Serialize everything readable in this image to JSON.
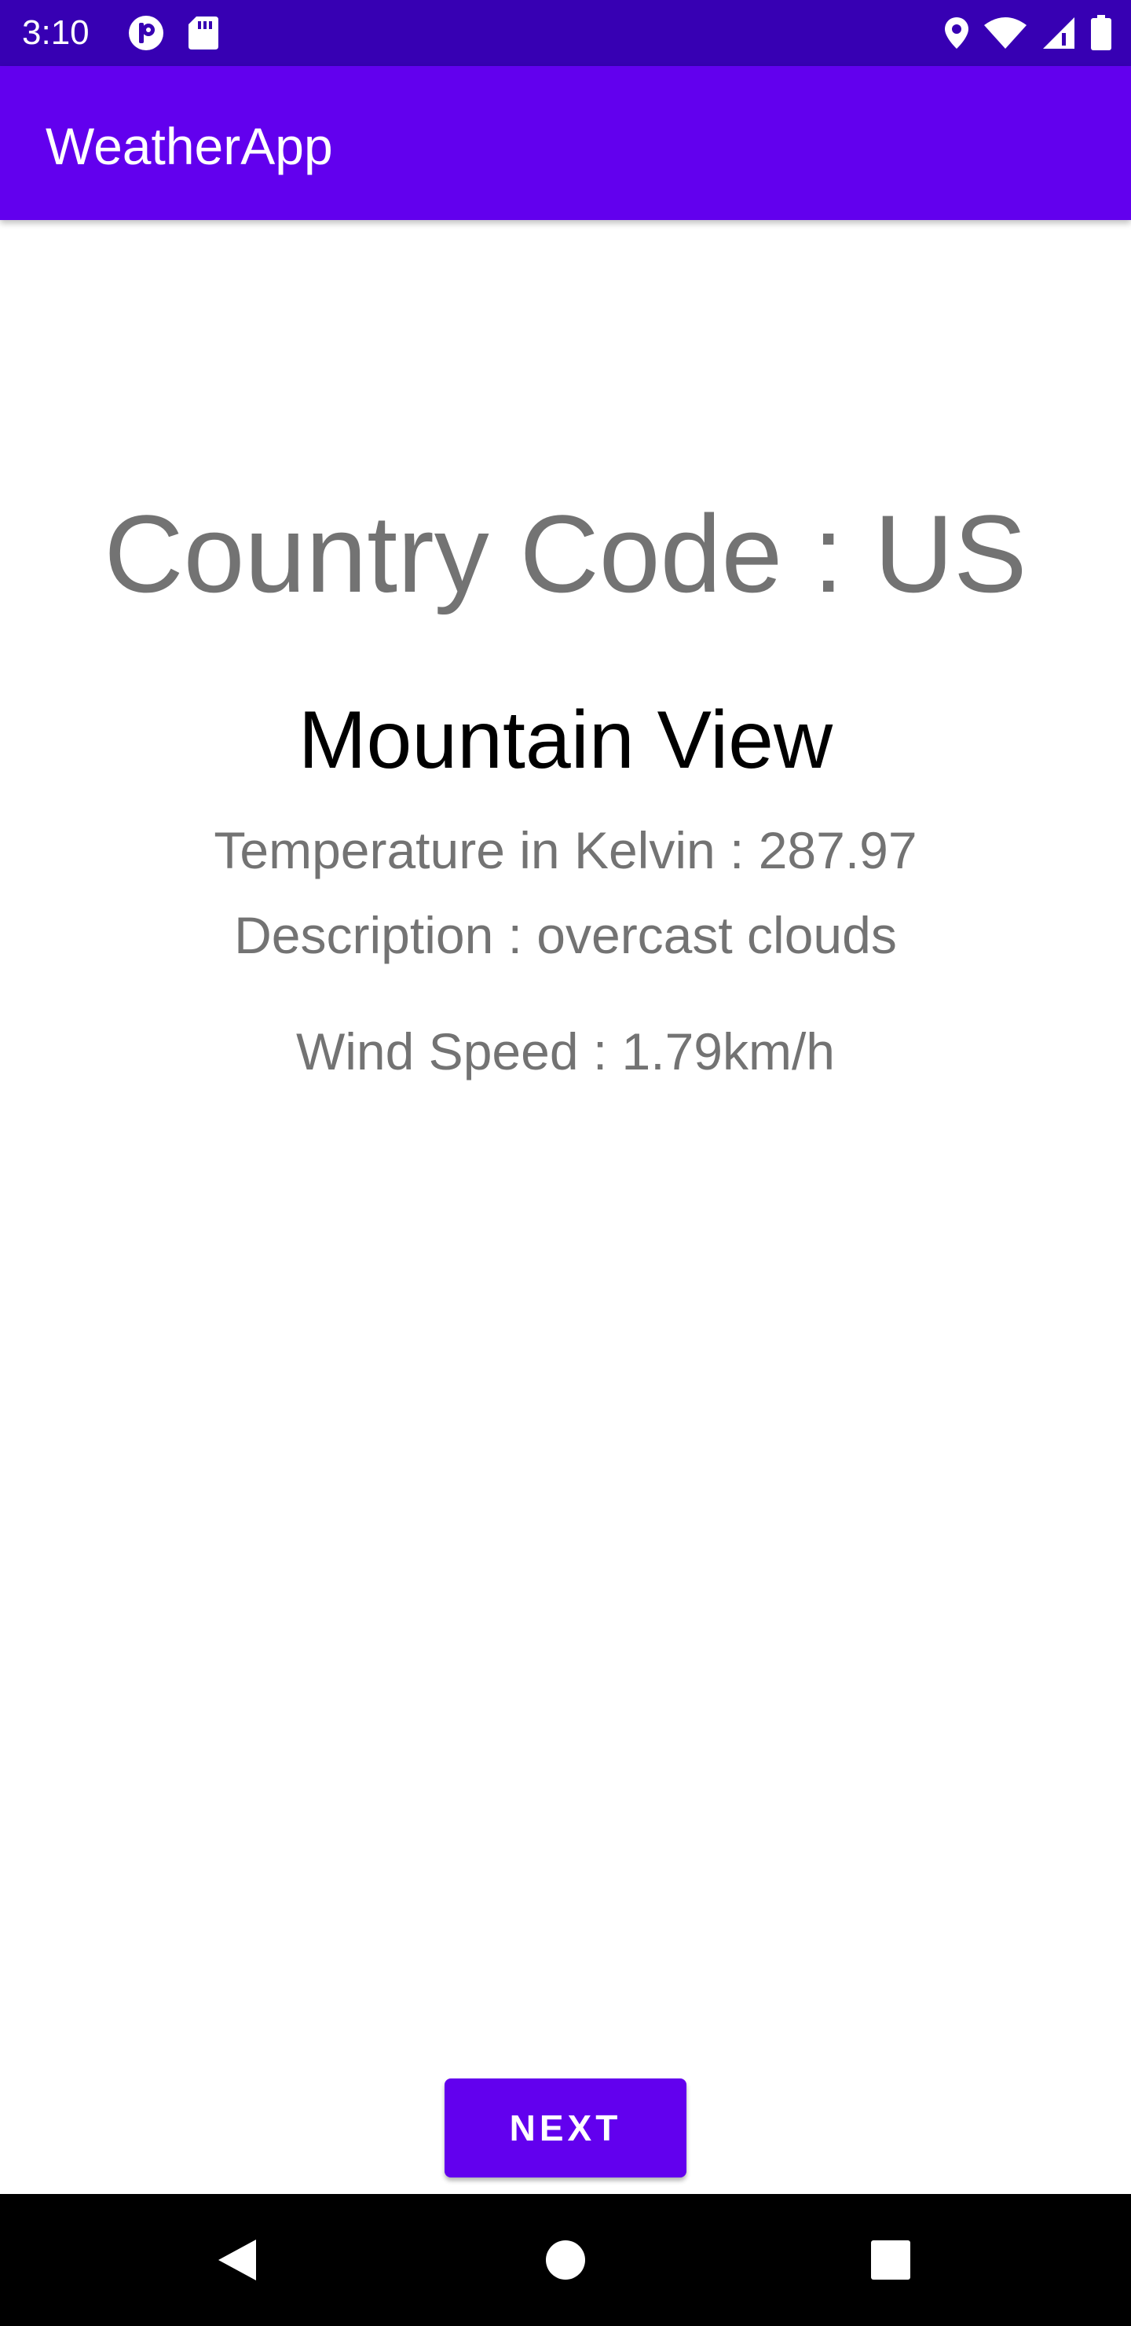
{
  "status_bar": {
    "time": "3:10",
    "icons": [
      "notification-app-icon",
      "sd-card-icon",
      "location-icon",
      "wifi-icon",
      "signal-icon",
      "battery-icon"
    ],
    "background_color": "#3700b3"
  },
  "app_bar": {
    "title": "WeatherApp",
    "background_color": "#6200ee"
  },
  "weather": {
    "country_code": "Country Code : US",
    "city": "Mountain View",
    "temperature": "Temperature in Kelvin : 287.97",
    "description": "Description : overcast clouds",
    "wind_speed": "Wind Speed : 1.79km/h"
  },
  "actions": {
    "next_label": "NEXT",
    "accent_color": "#6200ee"
  },
  "nav_bar": {
    "icons": [
      "back-icon",
      "home-icon",
      "recents-icon"
    ]
  }
}
